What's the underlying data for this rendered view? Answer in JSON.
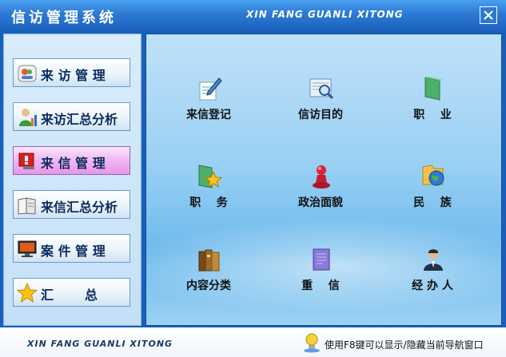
{
  "window": {
    "title": "信访管理系统",
    "subtitle": "XIN FANG GUANLI XITONG"
  },
  "sidebar": {
    "items": [
      {
        "label": "来 访 管 理",
        "icon": "visitors-icon",
        "active": false
      },
      {
        "label": "来访汇总分析",
        "icon": "user-stats-icon",
        "active": false
      },
      {
        "label": "来 信 管 理",
        "icon": "alert-icon",
        "active": true
      },
      {
        "label": "来信汇总分析",
        "icon": "book-icon",
        "active": false
      },
      {
        "label": "案 件 管 理",
        "icon": "monitor-icon",
        "active": false
      },
      {
        "label": "汇       总",
        "icon": "star-icon",
        "active": false
      }
    ]
  },
  "main": {
    "tiles": [
      {
        "label": "来信登记",
        "icon": "pencil-paper-icon"
      },
      {
        "label": "信访目的",
        "icon": "magnifier-icon"
      },
      {
        "label": "职    业",
        "icon": "folder-icon"
      },
      {
        "label": "职    务",
        "icon": "star-folder-icon"
      },
      {
        "label": "政治面貌",
        "icon": "pawn-icon"
      },
      {
        "label": "民    族",
        "icon": "globe-folder-icon"
      },
      {
        "label": "内容分类",
        "icon": "books-icon"
      },
      {
        "label": "重    信",
        "icon": "document-icon"
      },
      {
        "label": "经 办 人",
        "icon": "person-icon"
      }
    ]
  },
  "statusbar": {
    "brand": "XIN FANG GUANLI XITONG",
    "hint": "使用F8键可以显示/隐藏当前导航窗口"
  },
  "colors": {
    "titlebar": "#2b7ad4",
    "active_nav": "#e796e7",
    "content_bg": "#9ad0f4"
  }
}
